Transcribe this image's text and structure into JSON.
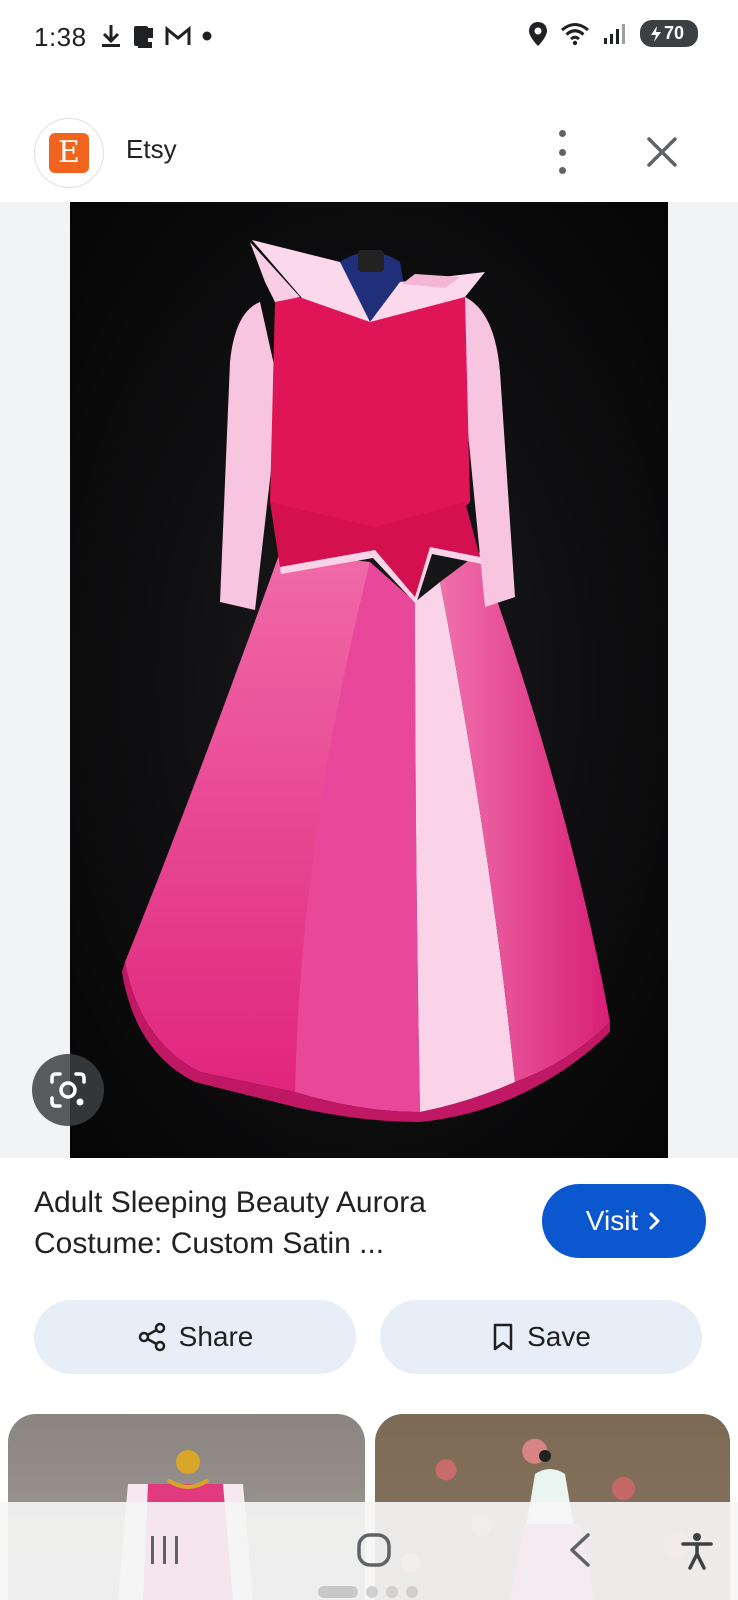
{
  "status_bar": {
    "time": "1:38",
    "battery": "70",
    "left_icons": [
      "download-icon",
      "sim-icon",
      "gmail-icon",
      "notification-dot-icon"
    ],
    "right_icons": [
      "location-icon",
      "wifi-icon",
      "signal-icon",
      "battery-icon"
    ]
  },
  "header": {
    "favicon_letter": "E",
    "site_name": "Etsy"
  },
  "result": {
    "title": "Adult Sleeping Beauty Aurora Costume: Custom Satin ...",
    "visit_label": "Visit"
  },
  "actions": {
    "share_label": "Share",
    "save_label": "Save"
  },
  "colors": {
    "visit_blue": "#0b57d0",
    "pill_bg": "#e8eef8",
    "etsy_orange": "#f1641e"
  }
}
